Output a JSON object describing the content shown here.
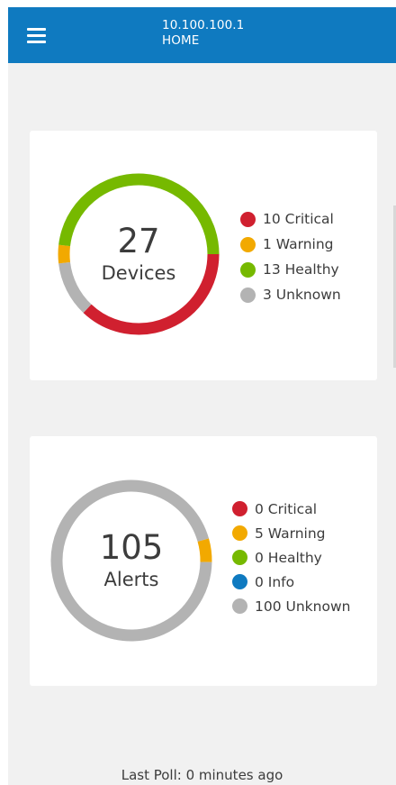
{
  "header": {
    "ip": "10.100.100.1",
    "page": "HOME"
  },
  "devices": {
    "total": "27",
    "label": "Devices",
    "colors": {
      "critical": "#d0202f",
      "warning": "#f2a900",
      "healthy": "#76b900",
      "unknown": "#b3b3b3"
    },
    "legend": [
      {
        "key": "critical",
        "count": 10,
        "text": "10 Critical",
        "color": "#d0202f"
      },
      {
        "key": "warning",
        "count": 1,
        "text": "1 Warning",
        "color": "#f2a900"
      },
      {
        "key": "healthy",
        "count": 13,
        "text": "13 Healthy",
        "color": "#76b900"
      },
      {
        "key": "unknown",
        "count": 3,
        "text": "3 Unknown",
        "color": "#b3b3b3"
      }
    ]
  },
  "alerts": {
    "total": "105",
    "label": "Alerts",
    "legend": [
      {
        "key": "critical",
        "count": 0,
        "text": "0 Critical",
        "color": "#d0202f"
      },
      {
        "key": "warning",
        "count": 5,
        "text": "5 Warning",
        "color": "#f2a900"
      },
      {
        "key": "healthy",
        "count": 0,
        "text": "0 Healthy",
        "color": "#76b900"
      },
      {
        "key": "info",
        "count": 0,
        "text": "0 Info",
        "color": "#0f7ac0"
      },
      {
        "key": "unknown",
        "count": 100,
        "text": "100 Unknown",
        "color": "#b3b3b3"
      }
    ]
  },
  "footer": {
    "last_poll": "Last Poll: 0 minutes ago"
  },
  "icons": {
    "menu": "menu-icon"
  },
  "theme": {
    "header_bg": "#0f7ac0",
    "page_bg": "#f1f1f1",
    "card_bg": "#ffffff",
    "text": "#3c3c3c"
  }
}
